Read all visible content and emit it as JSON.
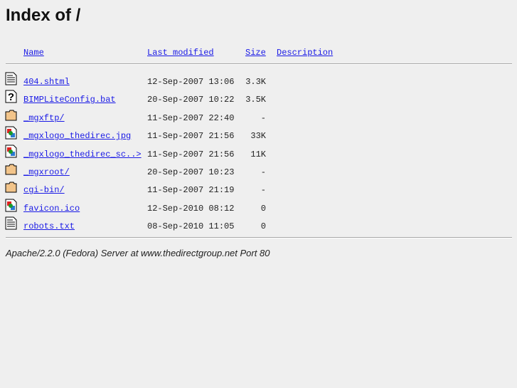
{
  "title": "Index of /",
  "columns": {
    "name": "Name",
    "modified": "Last modified",
    "size": "Size",
    "description": "Description"
  },
  "rows": [
    {
      "icon": "text-file",
      "name": "404.shtml",
      "modified": "12-Sep-2007 13:06",
      "size": "3.3K"
    },
    {
      "icon": "unknown-file",
      "name": "BIMPLiteConfig.bat",
      "modified": "20-Sep-2007 10:22",
      "size": "3.5K"
    },
    {
      "icon": "folder",
      "name": "_mgxftp/",
      "modified": "11-Sep-2007 22:40",
      "size": "-"
    },
    {
      "icon": "image-file",
      "name": "_mgxlogo_thedirec.jpg",
      "modified": "11-Sep-2007 21:56",
      "size": "33K"
    },
    {
      "icon": "image-file",
      "name": "_mgxlogo_thedirec_sc..>",
      "modified": "11-Sep-2007 21:56",
      "size": "11K"
    },
    {
      "icon": "folder",
      "name": "_mgxroot/",
      "modified": "20-Sep-2007 10:23",
      "size": "-"
    },
    {
      "icon": "folder",
      "name": "cgi-bin/",
      "modified": "11-Sep-2007 21:19",
      "size": "-"
    },
    {
      "icon": "image-file",
      "name": "favicon.ico",
      "modified": "12-Sep-2010 08:12",
      "size": "0"
    },
    {
      "icon": "text-file",
      "name": "robots.txt",
      "modified": "08-Sep-2010 11:05",
      "size": "0"
    }
  ],
  "footer": "Apache/2.2.0 (Fedora) Server at www.thedirectgroup.net Port 80"
}
